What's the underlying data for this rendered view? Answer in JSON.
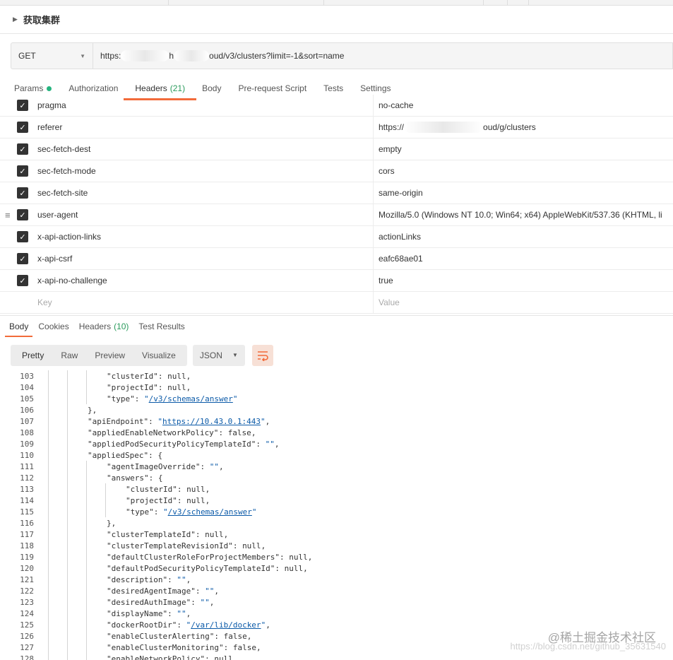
{
  "request": {
    "title": "获取集群",
    "method": "GET",
    "url_start": "https:",
    "url_mid": "h",
    "url_end": "oud/v3/clusters?limit=-1&sort=name"
  },
  "request_tabs": [
    {
      "label": "Params",
      "dot": true
    },
    {
      "label": "Authorization"
    },
    {
      "label": "Headers",
      "count": "(21)",
      "active": true
    },
    {
      "label": "Body"
    },
    {
      "label": "Pre-request Script"
    },
    {
      "label": "Tests"
    },
    {
      "label": "Settings"
    }
  ],
  "headers": [
    {
      "key": "pragma",
      "value": "no-cache"
    },
    {
      "key": "referer",
      "value_start": "https://",
      "value_end": "oud/g/clusters"
    },
    {
      "key": "sec-fetch-dest",
      "value": "empty"
    },
    {
      "key": "sec-fetch-mode",
      "value": "cors"
    },
    {
      "key": "sec-fetch-site",
      "value": "same-origin"
    },
    {
      "key": "user-agent",
      "value": "Mozilla/5.0 (Windows NT 10.0; Win64; x64) AppleWebKit/537.36 (KHTML, li",
      "drag": true
    },
    {
      "key": "x-api-action-links",
      "value": "actionLinks"
    },
    {
      "key": "x-api-csrf",
      "value": "eafc68ae01"
    },
    {
      "key": "x-api-no-challenge",
      "value": "true"
    }
  ],
  "new_header": {
    "key_placeholder": "Key",
    "value_placeholder": "Value"
  },
  "response_tabs": [
    {
      "label": "Body",
      "active": true
    },
    {
      "label": "Cookies"
    },
    {
      "label": "Headers",
      "count": "(10)"
    },
    {
      "label": "Test Results"
    }
  ],
  "view_buttons": [
    "Pretty",
    "Raw",
    "Preview",
    "Visualize"
  ],
  "format": "JSON",
  "icons": {
    "wrap": "wrap-lines-icon",
    "dropdown": "chevron-down-icon",
    "check": "checkmark-icon",
    "drag": "drag-handle-icon"
  },
  "colors": {
    "accent": "#f26b3a",
    "green": "#26b47f"
  },
  "code_lines": [
    {
      "n": "103",
      "indent": 3,
      "tokens": [
        {
          "t": "\"clusterId\"",
          "c": "k"
        },
        {
          "t": ": "
        },
        {
          "t": "null",
          "c": "n"
        },
        {
          "t": ","
        }
      ]
    },
    {
      "n": "104",
      "indent": 3,
      "tokens": [
        {
          "t": "\"projectId\"",
          "c": "k"
        },
        {
          "t": ": "
        },
        {
          "t": "null",
          "c": "n"
        },
        {
          "t": ","
        }
      ]
    },
    {
      "n": "105",
      "indent": 3,
      "tokens": [
        {
          "t": "\"type\"",
          "c": "k"
        },
        {
          "t": ": "
        },
        {
          "t": "\"",
          "c": "s"
        },
        {
          "t": "/v3/schemas/answer",
          "c": "u"
        },
        {
          "t": "\"",
          "c": "s"
        }
      ]
    },
    {
      "n": "106",
      "indent": 2,
      "tokens": [
        {
          "t": "},"
        }
      ]
    },
    {
      "n": "107",
      "indent": 2,
      "tokens": [
        {
          "t": "\"apiEndpoint\"",
          "c": "k"
        },
        {
          "t": ": "
        },
        {
          "t": "\"",
          "c": "s"
        },
        {
          "t": "https://10.43.0.1:443",
          "c": "u"
        },
        {
          "t": "\"",
          "c": "s"
        },
        {
          "t": ","
        }
      ]
    },
    {
      "n": "108",
      "indent": 2,
      "tokens": [
        {
          "t": "\"appliedEnableNetworkPolicy\"",
          "c": "k"
        },
        {
          "t": ": "
        },
        {
          "t": "false",
          "c": "n"
        },
        {
          "t": ","
        }
      ]
    },
    {
      "n": "109",
      "indent": 2,
      "tokens": [
        {
          "t": "\"appliedPodSecurityPolicyTemplateId\"",
          "c": "k"
        },
        {
          "t": ": "
        },
        {
          "t": "\"\"",
          "c": "s"
        },
        {
          "t": ","
        }
      ]
    },
    {
      "n": "110",
      "indent": 2,
      "tokens": [
        {
          "t": "\"appliedSpec\"",
          "c": "k"
        },
        {
          "t": ": {"
        }
      ]
    },
    {
      "n": "111",
      "indent": 3,
      "tokens": [
        {
          "t": "\"agentImageOverride\"",
          "c": "k"
        },
        {
          "t": ": "
        },
        {
          "t": "\"\"",
          "c": "s"
        },
        {
          "t": ","
        }
      ]
    },
    {
      "n": "112",
      "indent": 3,
      "tokens": [
        {
          "t": "\"answers\"",
          "c": "k"
        },
        {
          "t": ": {"
        }
      ]
    },
    {
      "n": "113",
      "indent": 4,
      "tokens": [
        {
          "t": "\"clusterId\"",
          "c": "k"
        },
        {
          "t": ": "
        },
        {
          "t": "null",
          "c": "n"
        },
        {
          "t": ","
        }
      ]
    },
    {
      "n": "114",
      "indent": 4,
      "tokens": [
        {
          "t": "\"projectId\"",
          "c": "k"
        },
        {
          "t": ": "
        },
        {
          "t": "null",
          "c": "n"
        },
        {
          "t": ","
        }
      ]
    },
    {
      "n": "115",
      "indent": 4,
      "tokens": [
        {
          "t": "\"type\"",
          "c": "k"
        },
        {
          "t": ": "
        },
        {
          "t": "\"",
          "c": "s"
        },
        {
          "t": "/v3/schemas/answer",
          "c": "u"
        },
        {
          "t": "\"",
          "c": "s"
        }
      ]
    },
    {
      "n": "116",
      "indent": 3,
      "tokens": [
        {
          "t": "},"
        }
      ]
    },
    {
      "n": "117",
      "indent": 3,
      "tokens": [
        {
          "t": "\"clusterTemplateId\"",
          "c": "k"
        },
        {
          "t": ": "
        },
        {
          "t": "null",
          "c": "n"
        },
        {
          "t": ","
        }
      ]
    },
    {
      "n": "118",
      "indent": 3,
      "tokens": [
        {
          "t": "\"clusterTemplateRevisionId\"",
          "c": "k"
        },
        {
          "t": ": "
        },
        {
          "t": "null",
          "c": "n"
        },
        {
          "t": ","
        }
      ]
    },
    {
      "n": "119",
      "indent": 3,
      "tokens": [
        {
          "t": "\"defaultClusterRoleForProjectMembers\"",
          "c": "k"
        },
        {
          "t": ": "
        },
        {
          "t": "null",
          "c": "n"
        },
        {
          "t": ","
        }
      ]
    },
    {
      "n": "120",
      "indent": 3,
      "tokens": [
        {
          "t": "\"defaultPodSecurityPolicyTemplateId\"",
          "c": "k"
        },
        {
          "t": ": "
        },
        {
          "t": "null",
          "c": "n"
        },
        {
          "t": ","
        }
      ]
    },
    {
      "n": "121",
      "indent": 3,
      "tokens": [
        {
          "t": "\"description\"",
          "c": "k"
        },
        {
          "t": ": "
        },
        {
          "t": "\"\"",
          "c": "s"
        },
        {
          "t": ","
        }
      ]
    },
    {
      "n": "122",
      "indent": 3,
      "tokens": [
        {
          "t": "\"desiredAgentImage\"",
          "c": "k"
        },
        {
          "t": ": "
        },
        {
          "t": "\"\"",
          "c": "s"
        },
        {
          "t": ","
        }
      ]
    },
    {
      "n": "123",
      "indent": 3,
      "tokens": [
        {
          "t": "\"desiredAuthImage\"",
          "c": "k"
        },
        {
          "t": ": "
        },
        {
          "t": "\"\"",
          "c": "s"
        },
        {
          "t": ","
        }
      ]
    },
    {
      "n": "124",
      "indent": 3,
      "tokens": [
        {
          "t": "\"displayName\"",
          "c": "k"
        },
        {
          "t": ": "
        },
        {
          "t": "\"\"",
          "c": "s"
        },
        {
          "t": ","
        }
      ]
    },
    {
      "n": "125",
      "indent": 3,
      "tokens": [
        {
          "t": "\"dockerRootDir\"",
          "c": "k"
        },
        {
          "t": ": "
        },
        {
          "t": "\"",
          "c": "s"
        },
        {
          "t": "/var/lib/docker",
          "c": "u"
        },
        {
          "t": "\"",
          "c": "s"
        },
        {
          "t": ","
        }
      ]
    },
    {
      "n": "126",
      "indent": 3,
      "tokens": [
        {
          "t": "\"enableClusterAlerting\"",
          "c": "k"
        },
        {
          "t": ": "
        },
        {
          "t": "false",
          "c": "n"
        },
        {
          "t": ","
        }
      ]
    },
    {
      "n": "127",
      "indent": 3,
      "tokens": [
        {
          "t": "\"enableClusterMonitoring\"",
          "c": "k"
        },
        {
          "t": ": "
        },
        {
          "t": "false",
          "c": "n"
        },
        {
          "t": ","
        }
      ]
    },
    {
      "n": "128",
      "indent": 3,
      "tokens": [
        {
          "t": "\"enableNetworkPolicy\"",
          "c": "k"
        },
        {
          "t": ": "
        },
        {
          "t": "null",
          "c": "n"
        },
        {
          "t": ","
        }
      ]
    }
  ],
  "watermark": {
    "line1": "@稀土掘金技术社区",
    "line2": "https://blog.csdn.net/github_35631540"
  }
}
